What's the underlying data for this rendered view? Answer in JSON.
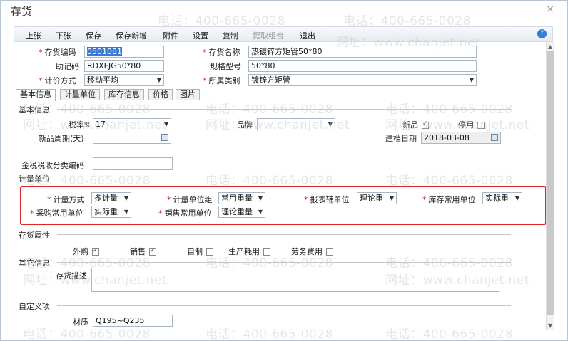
{
  "window": {
    "title": "存货",
    "close": "×"
  },
  "toolbar": {
    "items": [
      "上张",
      "下张",
      "保存",
      "保存新增",
      "附件",
      "设置",
      "复制",
      "提取组合",
      "退出"
    ],
    "help": "?"
  },
  "header": {
    "code_label": "存货编码",
    "code_value": "0501081",
    "name_label": "存货名称",
    "name_value": "热镀锌方矩管50*80",
    "mnemonic_label": "助记码",
    "mnemonic_value": "RDXFJG50*80",
    "spec_label": "规格型号",
    "spec_value": "50*80",
    "pricing_label": "计价方式",
    "pricing_value": "移动平均",
    "category_label": "所属类别",
    "category_value": "镀锌方矩管"
  },
  "tabs": [
    "基本信息",
    "计量单位",
    "库存信息",
    "价格",
    "图片"
  ],
  "basic": {
    "section": "基本信息",
    "tax_label": "税率%",
    "tax_value": "17",
    "brand_label": "品牌",
    "brand_value": "",
    "new_label": "新品",
    "new_checked": true,
    "disabled_label": "停用",
    "disabled_checked": false,
    "cycle_label": "新品周期(天)",
    "cycle_value": "",
    "created_label": "建档日期",
    "created_value": "2018-03-08",
    "taxcode_label": "金税税收分类编码",
    "taxcode_value": ""
  },
  "units": {
    "section": "计量单位",
    "method_label": "计量方式",
    "method_value": "多计量",
    "group_label": "计量单位组",
    "group_value": "常用重量",
    "report_label": "报表辅单位",
    "report_value": "理论重",
    "stock_label": "库存常用单位",
    "stock_value": "实际重",
    "purchase_label": "采购常用单位",
    "purchase_value": "实际重",
    "sales_label": "销售常用单位",
    "sales_value": "理论重量"
  },
  "attributes": {
    "section": "存货属性",
    "items": [
      {
        "label": "外购",
        "checked": true
      },
      {
        "label": "销售",
        "checked": true
      },
      {
        "label": "自制",
        "checked": false
      },
      {
        "label": "生产耗用",
        "checked": false
      },
      {
        "label": "劳务费用",
        "checked": false
      }
    ]
  },
  "other": {
    "section": "其它信息",
    "desc_label": "存货描述",
    "desc_value": ""
  },
  "custom": {
    "section": "自定义项",
    "material_label": "材质",
    "material_value": "Q195~Q235"
  },
  "watermark": {
    "phone": "电话：400-665-0028",
    "site": "网址：www.chanjet.net"
  }
}
